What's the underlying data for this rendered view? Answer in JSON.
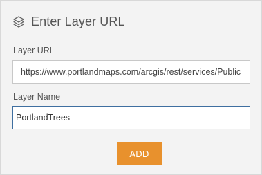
{
  "header": {
    "icon": "layers-icon",
    "title": "Enter Layer URL"
  },
  "form": {
    "url_label": "Layer URL",
    "url_value": "https://www.portlandmaps.com/arcgis/rest/services/Public",
    "name_label": "Layer Name",
    "name_value": "PortlandTrees"
  },
  "actions": {
    "add_label": "ADD"
  },
  "colors": {
    "panel_bg": "#f3f3f3",
    "button_bg": "#e8912d",
    "focus_border": "#3f6fa0",
    "text": "#555555"
  }
}
